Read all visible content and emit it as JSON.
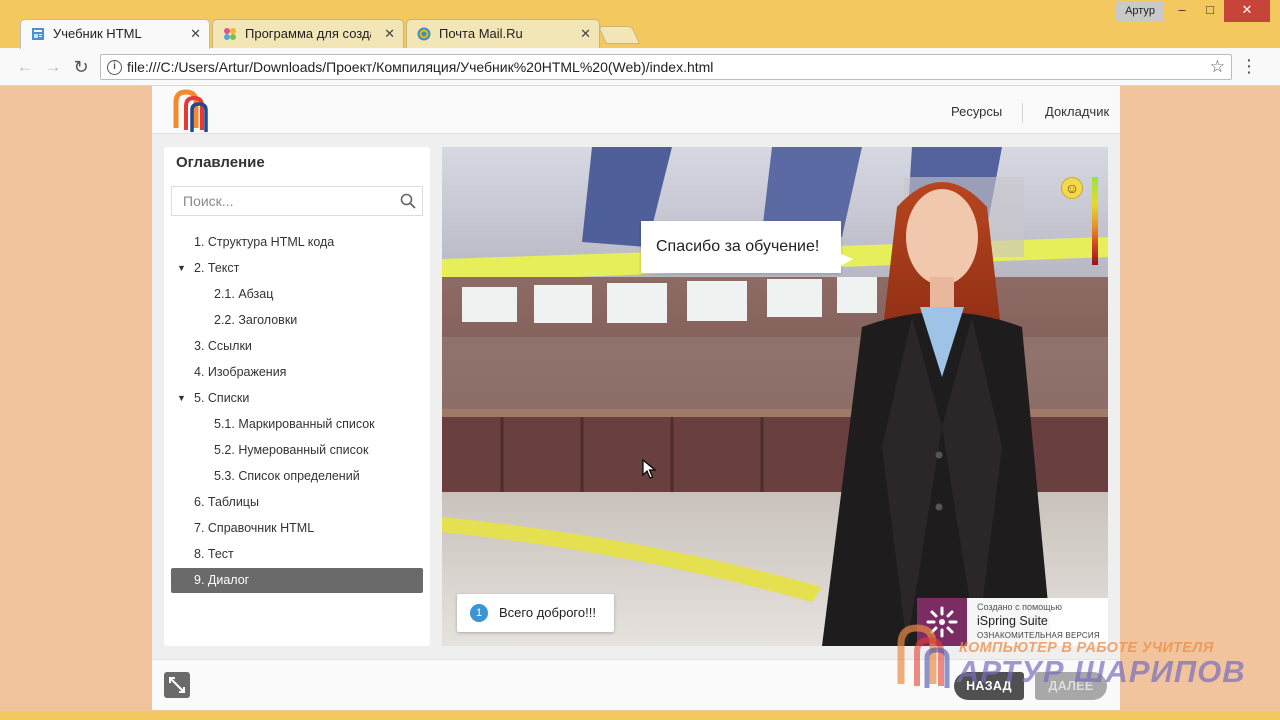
{
  "window": {
    "user_name": "Артур",
    "minimize": "–",
    "maximize": "□",
    "close": "✕"
  },
  "tabs": [
    {
      "label": "Учебник HTML",
      "icon": "page-icon",
      "active": true
    },
    {
      "label": "Программа для создания",
      "icon": "pinwheel-icon",
      "active": false
    },
    {
      "label": "Почта Mail.Ru",
      "icon": "mail-at-icon",
      "active": false
    }
  ],
  "address_bar": {
    "url": "file:///C:/Users/Artur/Downloads/Проект/Компиляция/Учебник%20HTML%20(Web)/index.html"
  },
  "player": {
    "header_links": {
      "resources": "Ресурсы",
      "presenter": "Докладчик"
    },
    "sidebar": {
      "title": "Оглавление",
      "search_placeholder": "Поиск...",
      "items": [
        {
          "label": "1. Структура HTML кода",
          "level": 1
        },
        {
          "label": "2. Текст",
          "level": 1,
          "expanded": true
        },
        {
          "label": "2.1. Абзац",
          "level": 2
        },
        {
          "label": "2.2. Заголовки",
          "level": 2
        },
        {
          "label": "3. Ссылки",
          "level": 1
        },
        {
          "label": "4. Изображения",
          "level": 1
        },
        {
          "label": "5. Списки",
          "level": 1,
          "expanded": true
        },
        {
          "label": "5.1. Маркированный список",
          "level": 2
        },
        {
          "label": "5.2. Нумерованный список",
          "level": 2
        },
        {
          "label": "5.3. Список определений",
          "level": 2
        },
        {
          "label": "6. Таблицы",
          "level": 1
        },
        {
          "label": "7. Справочник HTML",
          "level": 1
        },
        {
          "label": "8. Тест",
          "level": 1
        },
        {
          "label": "9. Диалог",
          "level": 1,
          "active": true
        }
      ]
    },
    "slide": {
      "speech": "Спасибо за обучение!",
      "reply_number": "1",
      "reply_text": "Всего доброго!!!",
      "branding": {
        "line1": "Создано с помощью",
        "line2": "iSpring Suite",
        "line3": "ОЗНАКОМИТЕЛЬНАЯ ВЕРСИЯ"
      }
    },
    "nav": {
      "back": "НАЗАД",
      "next": "ДАЛЕЕ"
    }
  },
  "watermark": {
    "line1": "КОМПЬЮТЕР В РАБОТЕ УЧИТЕЛЯ",
    "line2": "АРТУР ШАРИПОВ"
  },
  "colors": {
    "titlebar": "#f2c85f",
    "page_background": "#f2c49d",
    "toc_active": "#6a6a6a",
    "reply_badge": "#3b95d3",
    "ispring_brand": "#7b2d63"
  }
}
